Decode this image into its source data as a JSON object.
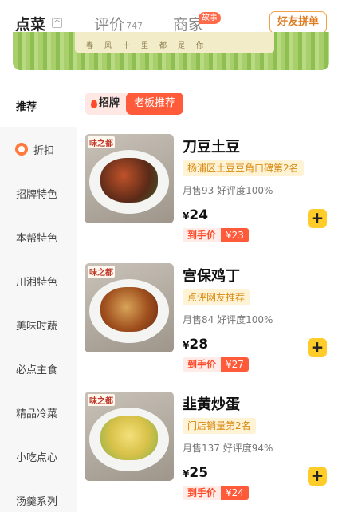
{
  "tabs": {
    "order_label": "点菜",
    "sort_badge": "不",
    "reviews_label": "评价",
    "reviews_count": "747",
    "merchant_label": "商家",
    "story_badge": "故事",
    "group_order": "好友拼单"
  },
  "banner": {
    "text": "春风十里都是你"
  },
  "sidebar": {
    "items": [
      {
        "label": "推荐",
        "active": true
      },
      {
        "label": "折扣",
        "icon": "discount-icon"
      },
      {
        "label": "招牌特色"
      },
      {
        "label": "本帮特色"
      },
      {
        "label": "川湘特色"
      },
      {
        "label": "美味时蔬"
      },
      {
        "label": "必点主食"
      },
      {
        "label": "精品冷菜"
      },
      {
        "label": "小吃点心"
      },
      {
        "label": "汤羹系列"
      }
    ]
  },
  "section": {
    "tag_label": "招牌",
    "tag_boss": "老板推荐"
  },
  "dishes": [
    {
      "name": "刀豆土豆",
      "rank": "杨浦区土豆豆角口碑第2名",
      "sales": "月售93",
      "rating": "好评度100%",
      "currency": "¥",
      "price": "24",
      "final_label": "到手价",
      "final_price": "¥23",
      "brand": "味之都"
    },
    {
      "name": "宫保鸡丁",
      "rank": "点评网友推荐",
      "sales": "月售84",
      "rating": "好评度100%",
      "currency": "¥",
      "price": "28",
      "final_label": "到手价",
      "final_price": "¥27",
      "brand": "味之都"
    },
    {
      "name": "韭黄炒蛋",
      "rank": "门店销量第2名",
      "sales": "月售137",
      "rating": "好评度94%",
      "currency": "¥",
      "price": "25",
      "final_label": "到手价",
      "final_price": "¥24",
      "brand": "味之都"
    }
  ],
  "colors": {
    "accent": "#ff5a3a",
    "add_button": "#ffcc29",
    "rank_text": "#d98a12"
  }
}
